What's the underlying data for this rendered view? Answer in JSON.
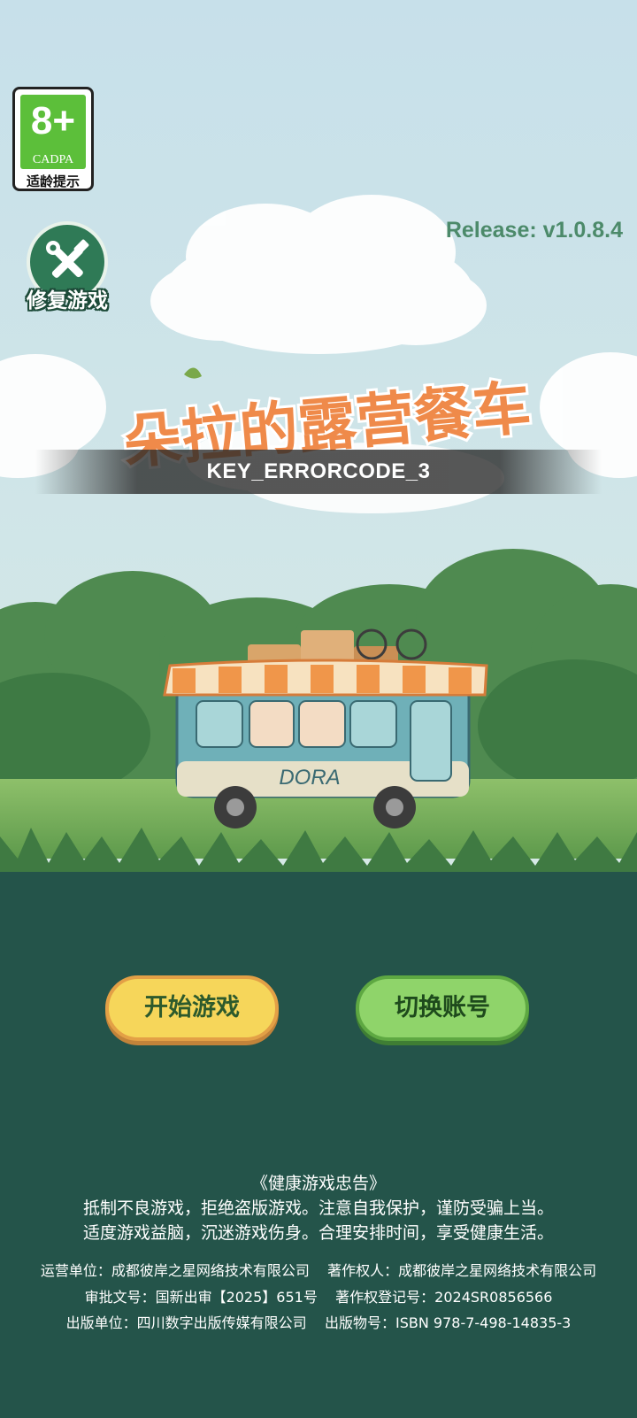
{
  "age_rating": {
    "number": "8+",
    "org": "CADPA",
    "label": "适龄提示"
  },
  "repair": {
    "label": "修复游戏",
    "icon": "wrench-hammer-icon"
  },
  "version": "Release: v1.0.8.4",
  "logo": {
    "title": "朵拉的露营餐车"
  },
  "error_message": "KEY_ERRORCODE_3",
  "bus_label": "DORA",
  "buttons": {
    "start": "开始游戏",
    "switch_account": "切换账号"
  },
  "notice": {
    "title": "《健康游戏忠告》",
    "line1": "抵制不良游戏，拒绝盗版游戏。注意自我保护，谨防受骗上当。",
    "line2": "适度游戏益脑，沉迷游戏伤身。合理安排时间，享受健康生活。"
  },
  "info": {
    "line1": "运营单位：成都彼岸之星网络技术有限公司    著作权人：成都彼岸之星网络技术有限公司",
    "line2": "审批文号：国新出审【2025】651号    著作权登记号：2024SR0856566",
    "line3": "出版单位：四川数字出版传媒有限公司    出版物号：ISBN 978-7-498-14835-3"
  },
  "colors": {
    "sky": "#cde3ea",
    "ground": "#24544a",
    "start_button": "#f6d65a",
    "switch_button": "#8fd46a"
  }
}
